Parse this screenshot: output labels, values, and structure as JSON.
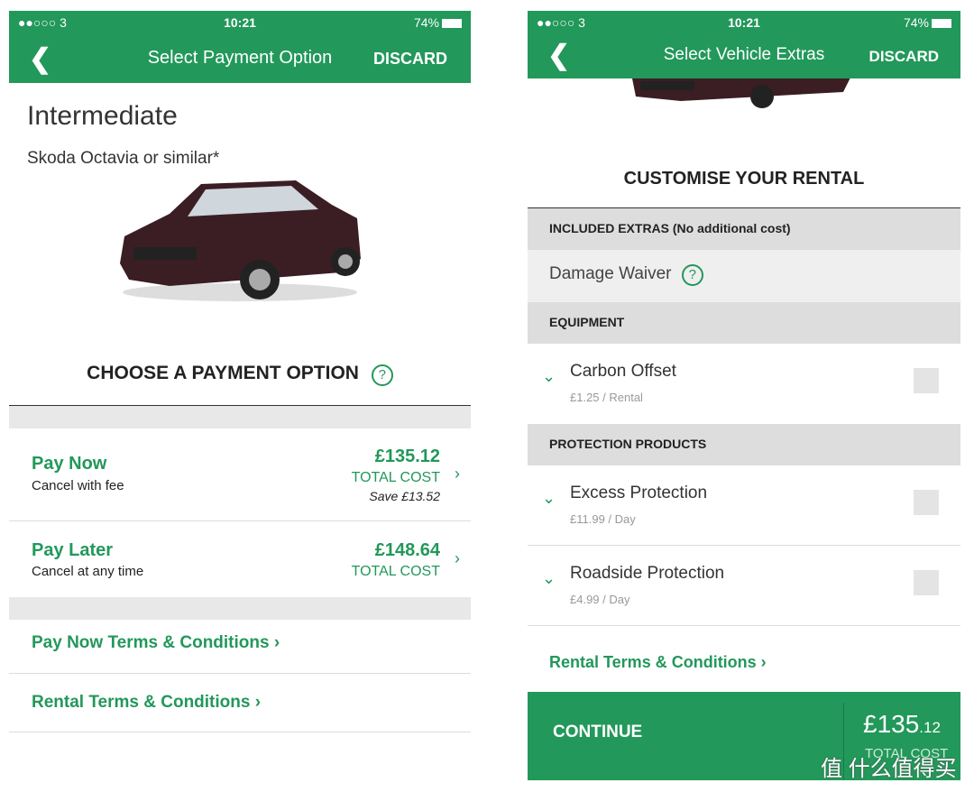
{
  "status_bar": {
    "carrier": "●●○○○ 3",
    "time": "10:21",
    "battery": "74%"
  },
  "left": {
    "nav": {
      "back": "❮",
      "title": "Select Payment Option",
      "discard": "DISCARD"
    },
    "vehicle_class": "Intermediate",
    "vehicle_model": "Skoda Octavia or similar*",
    "section_title": "CHOOSE A PAYMENT OPTION",
    "help": "?",
    "options": [
      {
        "name": "Pay Now",
        "desc": "Cancel with fee",
        "price": "£135.12",
        "price_label": "TOTAL COST",
        "save": "Save £13.52"
      },
      {
        "name": "Pay Later",
        "desc": "Cancel at any time",
        "price": "£148.64",
        "price_label": "TOTAL COST"
      }
    ],
    "links": [
      "Pay Now Terms & Conditions ›",
      "Rental Terms & Conditions ›"
    ]
  },
  "right": {
    "nav": {
      "back": "❮",
      "title": "Select Vehicle Extras",
      "discard": "DISCARD"
    },
    "section_title": "CUSTOMISE YOUR RENTAL",
    "included_header": "INCLUDED EXTRAS (No additional cost)",
    "included_item": "Damage Waiver",
    "help": "?",
    "equipment_header": "EQUIPMENT",
    "equipment": [
      {
        "name": "Carbon Offset",
        "price": "£1.25 / Rental"
      }
    ],
    "protection_header": "PROTECTION PRODUCTS",
    "protection": [
      {
        "name": "Excess Protection",
        "price": "£11.99 / Day"
      },
      {
        "name": "Roadside Protection",
        "price": "£4.99 / Day"
      }
    ],
    "link": "Rental Terms & Conditions ›",
    "footer": {
      "continue": "CONTINUE",
      "price_main": "£135",
      "price_cents": ".12",
      "price_label": "TOTAL COST"
    }
  },
  "watermark": "值 什么值得买",
  "colors": {
    "brand": "#22985a"
  }
}
